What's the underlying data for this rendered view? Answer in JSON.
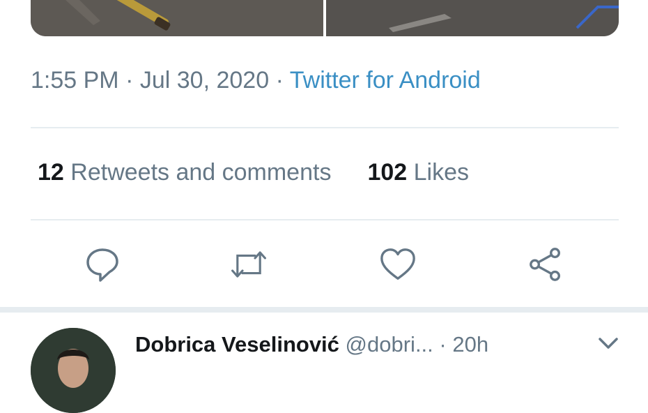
{
  "tweet": {
    "time": "1:55 PM",
    "date": "Jul 30, 2020",
    "separator": "·",
    "source": "Twitter for Android"
  },
  "stats": {
    "retweets_count": "12",
    "retweets_label": "Retweets and comments",
    "likes_count": "102",
    "likes_label": "Likes"
  },
  "actions": [
    "reply-icon",
    "retweet-icon",
    "like-icon",
    "share-icon"
  ],
  "reply": {
    "name": "Dobrica Veselinović",
    "handle": "@dobri...",
    "dot": "·",
    "time": "20h"
  },
  "colors": {
    "secondary_text": "#657786",
    "link": "#3a8fc4",
    "divider": "#e6ecf0",
    "primary_text": "#14171a"
  }
}
